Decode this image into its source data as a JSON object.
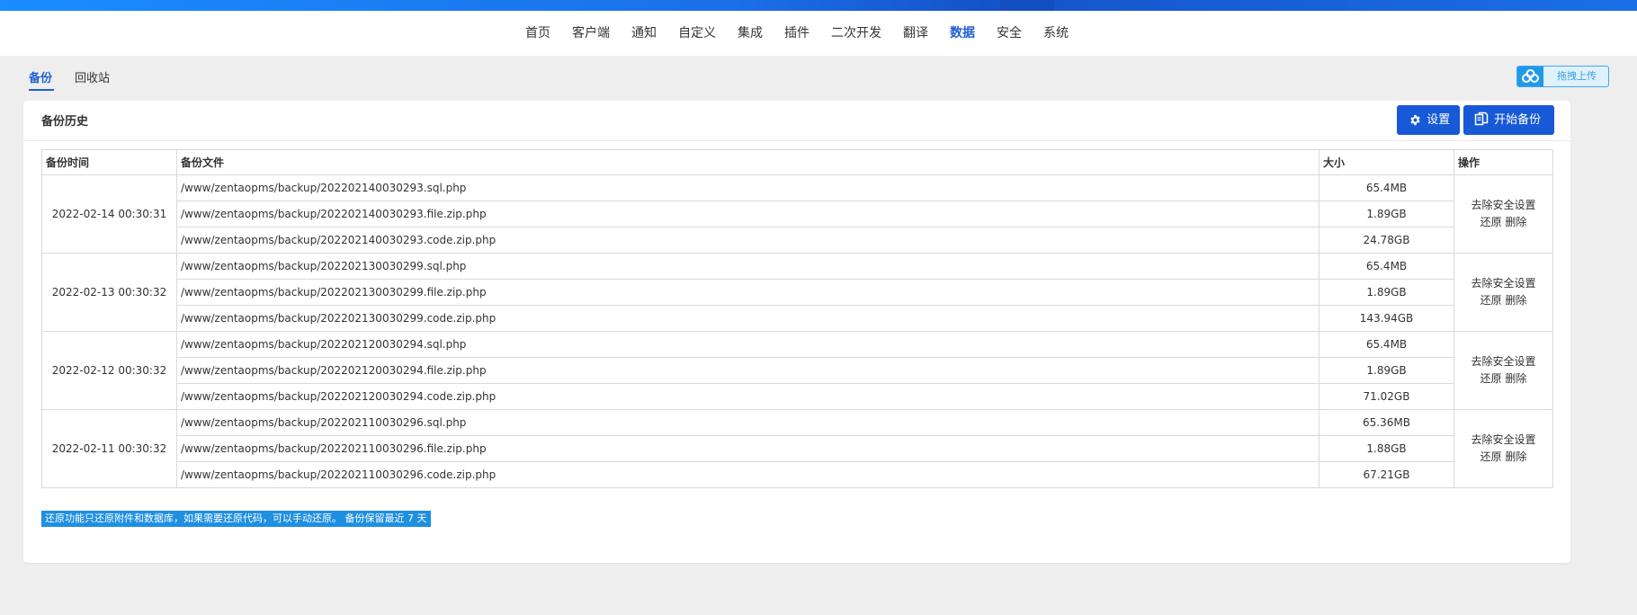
{
  "nav": {
    "items": [
      {
        "label": "首页",
        "active": false
      },
      {
        "label": "客户端",
        "active": false
      },
      {
        "label": "通知",
        "active": false
      },
      {
        "label": "自定义",
        "active": false
      },
      {
        "label": "集成",
        "active": false
      },
      {
        "label": "插件",
        "active": false
      },
      {
        "label": "二次开发",
        "active": false
      },
      {
        "label": "翻译",
        "active": false
      },
      {
        "label": "数据",
        "active": true
      },
      {
        "label": "安全",
        "active": false
      },
      {
        "label": "系统",
        "active": false
      }
    ]
  },
  "subnav": {
    "items": [
      {
        "label": "备份",
        "active": true
      },
      {
        "label": "回收站",
        "active": false
      }
    ]
  },
  "upload": {
    "label": "拖拽上传",
    "icon": "cloud-icon"
  },
  "panel": {
    "title": "备份历史",
    "settings_label": "设置",
    "settings_icon": "gear-icon",
    "backup_label": "开始备份",
    "backup_icon": "copy-icon"
  },
  "table": {
    "headers": {
      "time": "备份时间",
      "file": "备份文件",
      "size": "大小",
      "action": "操作"
    },
    "groups": [
      {
        "time": "2022-02-14 00:30:31",
        "files": [
          {
            "path": "/www/zentaopms/backup/202202140030293.sql.php",
            "size": "65.4MB"
          },
          {
            "path": "/www/zentaopms/backup/202202140030293.file.zip.php",
            "size": "1.89GB"
          },
          {
            "path": "/www/zentaopms/backup/202202140030293.code.zip.php",
            "size": "24.78GB"
          }
        ]
      },
      {
        "time": "2022-02-13 00:30:32",
        "files": [
          {
            "path": "/www/zentaopms/backup/202202130030299.sql.php",
            "size": "65.4MB"
          },
          {
            "path": "/www/zentaopms/backup/202202130030299.file.zip.php",
            "size": "1.89GB"
          },
          {
            "path": "/www/zentaopms/backup/202202130030299.code.zip.php",
            "size": "143.94GB"
          }
        ]
      },
      {
        "time": "2022-02-12 00:30:32",
        "files": [
          {
            "path": "/www/zentaopms/backup/202202120030294.sql.php",
            "size": "65.4MB"
          },
          {
            "path": "/www/zentaopms/backup/202202120030294.file.zip.php",
            "size": "1.89GB"
          },
          {
            "path": "/www/zentaopms/backup/202202120030294.code.zip.php",
            "size": "71.02GB"
          }
        ]
      },
      {
        "time": "2022-02-11 00:30:32",
        "files": [
          {
            "path": "/www/zentaopms/backup/202202110030296.sql.php",
            "size": "65.36MB"
          },
          {
            "path": "/www/zentaopms/backup/202202110030296.file.zip.php",
            "size": "1.88GB"
          },
          {
            "path": "/www/zentaopms/backup/202202110030296.code.zip.php",
            "size": "67.21GB"
          }
        ]
      }
    ],
    "actions": {
      "remove_security": "去除安全设置",
      "restore": "还原",
      "delete": "删除"
    }
  },
  "notice": "还原功能只还原附件和数据库，如果需要还原代码，可以手动还原。 备份保留最近 7 天",
  "colors": {
    "accent": "#1759d6",
    "nav_active": "#1f5fd6",
    "notice_bg": "#1e8fe1",
    "upload_bg": "#dff1fd"
  }
}
